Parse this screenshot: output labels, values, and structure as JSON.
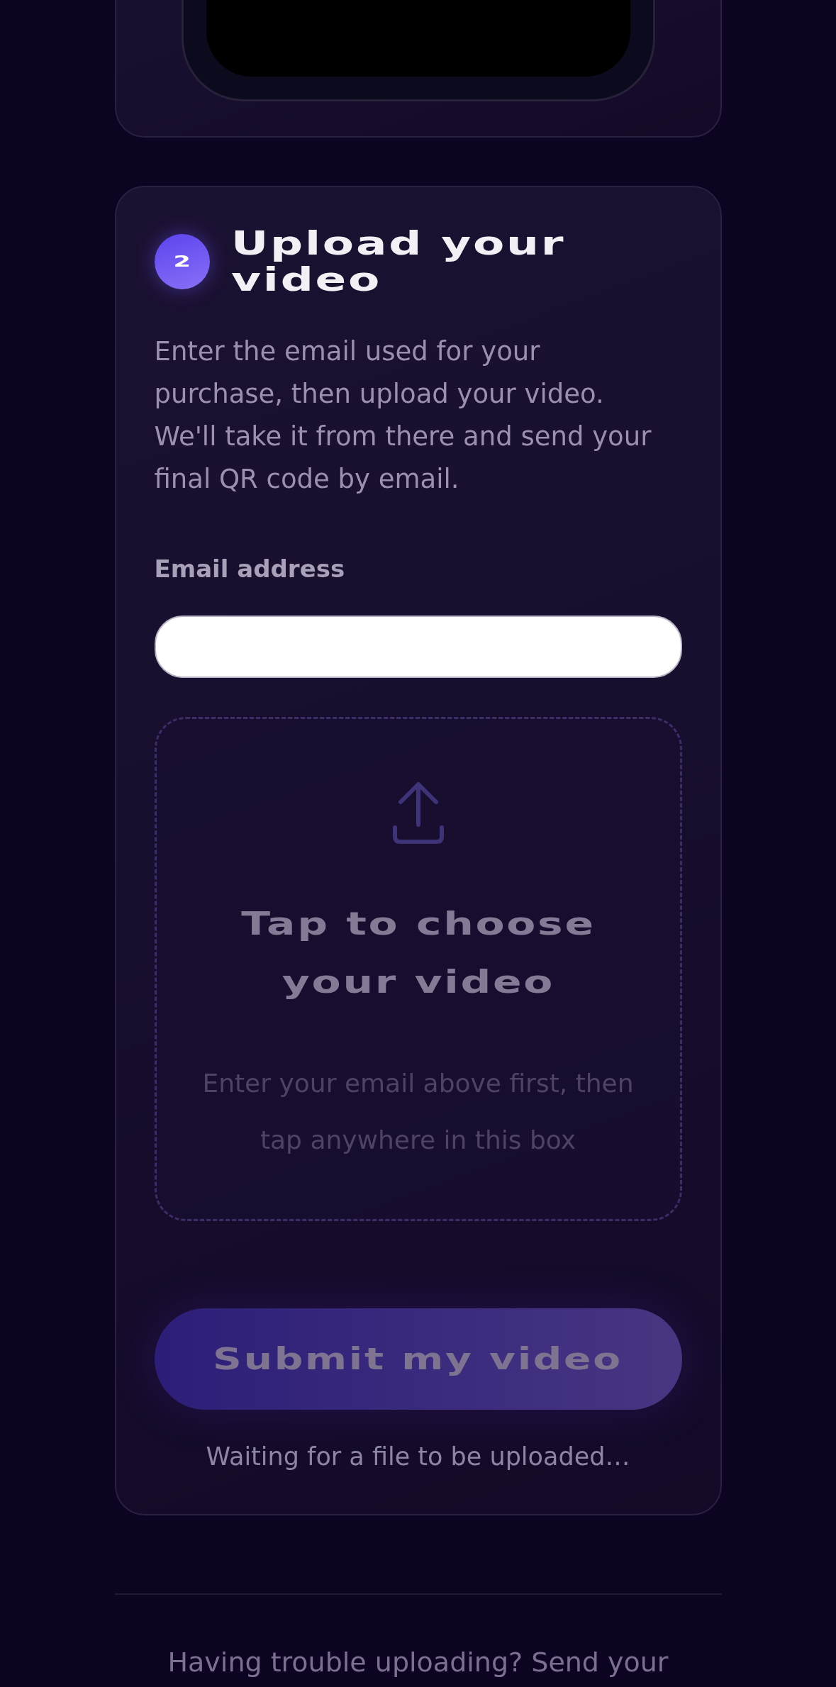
{
  "upload_step": {
    "number": "2",
    "title": "Upload your video",
    "description": "Enter the email used for your purchase, then upload your video. We'll take it from there and send your final QR code by email.",
    "email_field": {
      "label": "Email address"
    },
    "upload_area": {
      "title": "Tap to choose your video",
      "hint": "Enter your email above first, then tap anywhere in this box",
      "disabled": true
    },
    "submit_button": {
      "label": "Submit my video",
      "disabled": true
    },
    "status": "Waiting for a file to be uploaded…"
  },
  "footer": {
    "help_text": "Having trouble uploading? Send your"
  }
}
